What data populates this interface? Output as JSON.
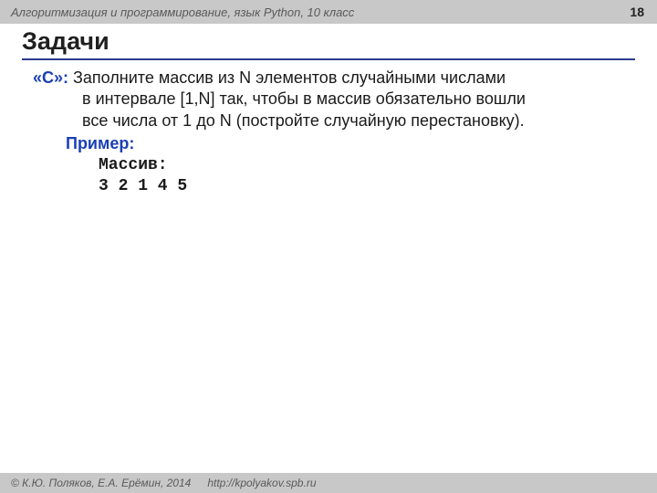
{
  "header": {
    "course": "Алгоритмизация и программирование, язык Python, 10 класс",
    "page": "18"
  },
  "title": "Задачи",
  "task": {
    "label": "«С»:",
    "line1": "Заполните массив из N элементов случайными числами",
    "line2": "в интервале [1,N] так, чтобы в массив обязательно вошли",
    "line3": "все числа от 1 до N (постройте случайную перестановку)."
  },
  "example": {
    "label": "Пример",
    "heading": "Массив:",
    "output": "3 2 1 4 5"
  },
  "footer": {
    "authors": "© К.Ю. Поляков, Е.А. Ерёмин, 2014",
    "url": "http://kpolyakov.spb.ru"
  }
}
